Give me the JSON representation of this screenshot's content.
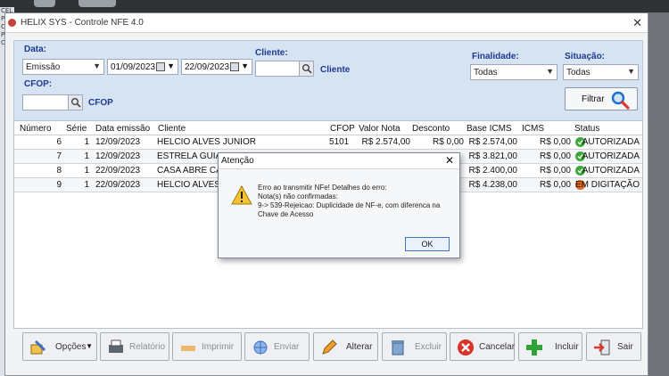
{
  "window": {
    "title": "HELIX SYS - Controle NFE 4.0"
  },
  "side_strip": [
    "CEL",
    "POS",
    "CEL",
    "POS",
    "CEL"
  ],
  "filters": {
    "data_label": "Data:",
    "data_type": "Emissão",
    "date_from": "01/09/2023",
    "date_to": "22/09/2023",
    "cliente_label": "Cliente:",
    "cliente_value": "",
    "cliente_link": "Cliente",
    "cfop_label": "CFOP:",
    "cfop_value": "",
    "cfop_link": "CFOP",
    "finalidade_label": "Finalidade:",
    "finalidade_value": "Todas",
    "situacao_label": "Situação:",
    "situacao_value": "Todas",
    "filtrar_label": "Filtrar"
  },
  "grid": {
    "columns": [
      "Número",
      "Série",
      "Data emissão",
      "Cliente",
      "CFOP",
      "Valor Nota",
      "Desconto",
      "Base ICMS",
      "ICMS",
      "Status"
    ],
    "rows": [
      {
        "numero": "6",
        "serie": "1",
        "data": "12/09/2023",
        "cliente": "HELCIO ALVES JUNIOR",
        "cfop": "5101",
        "valor": "R$ 2.574,00",
        "desconto": "R$ 0,00",
        "base": "R$ 2.574,00",
        "icms": "R$ 0,00",
        "status": "AUTORIZADA",
        "status_kind": "ok"
      },
      {
        "numero": "7",
        "serie": "1",
        "data": "12/09/2023",
        "cliente": "ESTRELA GUIA A",
        "cfop": "",
        "valor": "",
        "desconto": "",
        "base": "R$ 3.821,00",
        "icms": "R$ 0,00",
        "status": "AUTORIZADA",
        "status_kind": "ok"
      },
      {
        "numero": "8",
        "serie": "1",
        "data": "22/09/2023",
        "cliente": "CASA ABRE CAN",
        "cfop": "",
        "valor": "",
        "desconto": "",
        "base": "R$ 2.400,00",
        "icms": "R$ 0,00",
        "status": "AUTORIZADA",
        "status_kind": "ok"
      },
      {
        "numero": "9",
        "serie": "1",
        "data": "22/09/2023",
        "cliente": "HELCIO ALVES J",
        "cfop": "",
        "valor": "",
        "desconto": "",
        "base": "R$ 4.238,00",
        "icms": "R$ 0,00",
        "status": "EM DIGITAÇÃO",
        "status_kind": "warn"
      }
    ]
  },
  "dialog": {
    "title": "Atenção",
    "lines": [
      "Erro ao transmitir NFe! Detalhes do erro:",
      "Nota(s) não confirmadas:",
      "9-> 539-Rejeicao: Duplicidade de NF-e, com diferenca na",
      "Chave de Acesso"
    ],
    "ok_label": "OK"
  },
  "toolbar": {
    "opcoes": "Opções",
    "relatorio": "Relatório",
    "imprimir": "Imprimir",
    "enviar": "Enviar",
    "alterar": "Alterar",
    "excluir": "Excluir",
    "cancelar": "Cancelar",
    "incluir": "Incluir",
    "sair": "Sair"
  },
  "colors": {
    "accent": "#1d3a92",
    "ok": "#3ea63a",
    "warn": "#e06a1d",
    "filter_bg": "#d5e3f3"
  }
}
